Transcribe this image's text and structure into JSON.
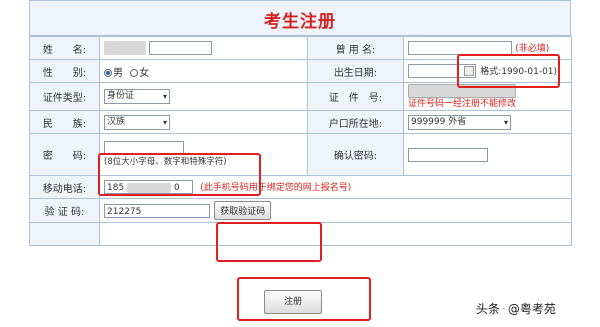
{
  "form": {
    "title": "考生注册",
    "labels": {
      "name": "姓　　名:",
      "former_name": "曾 用 名:",
      "gender": "性　　别:",
      "birth": "出生日期:",
      "id_type": "证件类型:",
      "id_no": "证　件　号:",
      "ethnicity": "民　　族:",
      "hukou": "户口所在地:",
      "password": "密　　码:",
      "confirm_password": "确认密码:",
      "phone": "移动电话:",
      "code": "验 证 码:"
    },
    "values": {
      "former_name_note": "(非必填)",
      "gender_male": "男",
      "gender_female": "女",
      "birth_format": "格式:1990-01-01)",
      "id_type": "身份证",
      "id_note": "证件号码一经注册不能修改",
      "ethnicity": "汉族",
      "hukou": "999999 外省",
      "password_hint": "(8位大小字母、数字和特殊字符)",
      "phone_prefix": "185",
      "phone_suffix": "0",
      "phone_note": "(此手机号码用于绑定您的网上报名号)",
      "code": "212275",
      "get_code_button": "获取验证码"
    },
    "submit_label": "注册"
  },
  "watermark": {
    "platform": "头条",
    "author": "@粤考苑"
  },
  "colors": {
    "label_bg": "#eef4f9",
    "border": "#aac3d9",
    "title": "#d61f1f",
    "highlight": "#e02020"
  }
}
